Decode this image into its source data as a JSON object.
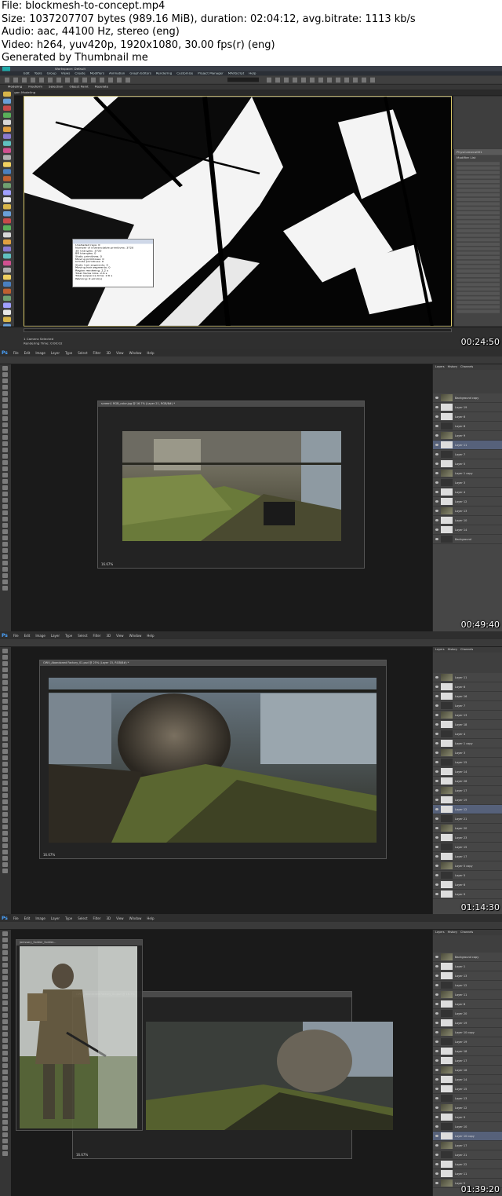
{
  "info": {
    "file": "File: blockmesh-to-concept.mp4",
    "size": "Size: 1037207707 bytes (989.16 MiB), duration: 02:04:12, avg.bitrate: 1113 kb/s",
    "audio": "Audio: aac, 44100 Hz, stereo (eng)",
    "video": "Video: h264, yuv420p, 1920x1080, 30.00 fps(r) (eng)",
    "generator": "Generated by Thumbnail me"
  },
  "frames": [
    {
      "timestamp": "00:24:50"
    },
    {
      "timestamp": "00:49:40"
    },
    {
      "timestamp": "01:14:30"
    },
    {
      "timestamp": "01:39:20"
    }
  ],
  "max": {
    "workspace": "Workspace: Default",
    "menu": [
      "Edit",
      "Tools",
      "Group",
      "Views",
      "Create",
      "Modifiers",
      "Animation",
      "Graph Editors",
      "Rendering",
      "Customize",
      "Project Manager",
      "MAXScript",
      "Help"
    ],
    "ribbon": [
      "Modeling",
      "Freeform",
      "Selection",
      "Object Paint",
      "Populate"
    ],
    "ribbon_sub": "Polygon Modeling",
    "stats_lines": [
      "Unshaded rays: 0",
      "Number of intersectable primitives: 3720",
      "3D triangles: 3720",
      "BR triangles: 0",
      "Static primitives: 0",
      "Moving primitives: 0",
      "Infinite primitives: 0",
      "Static hair segments: 0",
      "Moving hair segments: 0",
      "Region rendering: 2.2 s",
      "Total frame time: 2.6 s",
      "Total sequence time: 2.6 s",
      "Warning: 0 error(s)"
    ],
    "status": "1 Camera Selected",
    "status2": "Rendering Time: 0:00:02",
    "right_panel": [
      "PhysCamera001",
      "Modifier List"
    ],
    "icon_colors": [
      "#d9b64a",
      "#6aa0d8",
      "#c84a4a",
      "#5ab05a",
      "#d8d8d8",
      "#e0a040",
      "#8a7ad0",
      "#60c0c0",
      "#d05090",
      "#b0b0b0",
      "#f0d060",
      "#4a80c0",
      "#c06030",
      "#70a070",
      "#a0a0ff",
      "#e8e8e8",
      "#d9b64a",
      "#6aa0d8",
      "#c84a4a",
      "#5ab05a",
      "#d8d8d8",
      "#e0a040",
      "#8a7ad0",
      "#60c0c0",
      "#d05090",
      "#b0b0b0",
      "#f0d060",
      "#4a80c0",
      "#c06030",
      "#70a070",
      "#a0a0ff",
      "#e8e8e8",
      "#d9b64a",
      "#6aa0d8",
      "#c84a4a",
      "#5ab05a"
    ]
  },
  "ps": {
    "menu": [
      "File",
      "Edit",
      "Image",
      "Layer",
      "Type",
      "Select",
      "Filter",
      "3D",
      "View",
      "Window",
      "Help"
    ],
    "logo": "Ps",
    "panel_tabs": [
      "Layers",
      "History",
      "Channels"
    ],
    "doc1_title": "screen1 RGB_color.jpg @ 16.7% (Layer 21, RGB/8#) *",
    "doc2_title": "OWV_Abandoned Factory_01.psd @ 25% (Layer 15, RGB/8#) *",
    "doc3a_title": "Janissary_Soldier_Soldier...",
    "doc3b_title": "OWV_Abandoned Factory_01.psd @ 16.7%",
    "doc_zoom": "16.67%",
    "layers1": [
      "Background copy",
      "Layer 19",
      "Layer 6",
      "Layer 8",
      "Layer 9",
      "Layer 11",
      "Layer 7",
      "Layer 5",
      "Layer 1 copy",
      "Layer 3",
      "Layer 4",
      "Layer 12",
      "Layer 13",
      "Layer 10",
      "Layer 14",
      "Background"
    ],
    "layers2": [
      "Layer 11",
      "Layer 6",
      "Layer 16",
      "Layer 7",
      "Layer 13",
      "Layer 18",
      "Layer 4",
      "Layer 1 copy",
      "Layer 3",
      "Layer 15",
      "Layer 14",
      "Layer 26",
      "Layer 17",
      "Layer 19",
      "Layer 12",
      "Layer 21",
      "Layer 20",
      "Layer 23",
      "Layer 15",
      "Layer 17",
      "Layer 5 copy",
      "Layer 5",
      "Layer 6",
      "Layer 9"
    ],
    "layers3": [
      "Background copy",
      "Layer 1",
      "Layer 13",
      "Layer 12",
      "Layer 11",
      "Layer 8",
      "Layer 20",
      "Layer 19",
      "Layer 10 copy",
      "Layer 19",
      "Layer 18",
      "Layer 17",
      "Layer 16",
      "Layer 14",
      "Layer 15",
      "Layer 13",
      "Layer 12",
      "Layer 9",
      "Layer 10",
      "Layer 10 copy",
      "Layer 17",
      "Layer 21",
      "Layer 22",
      "Layer 11",
      "Layer 5"
    ]
  }
}
